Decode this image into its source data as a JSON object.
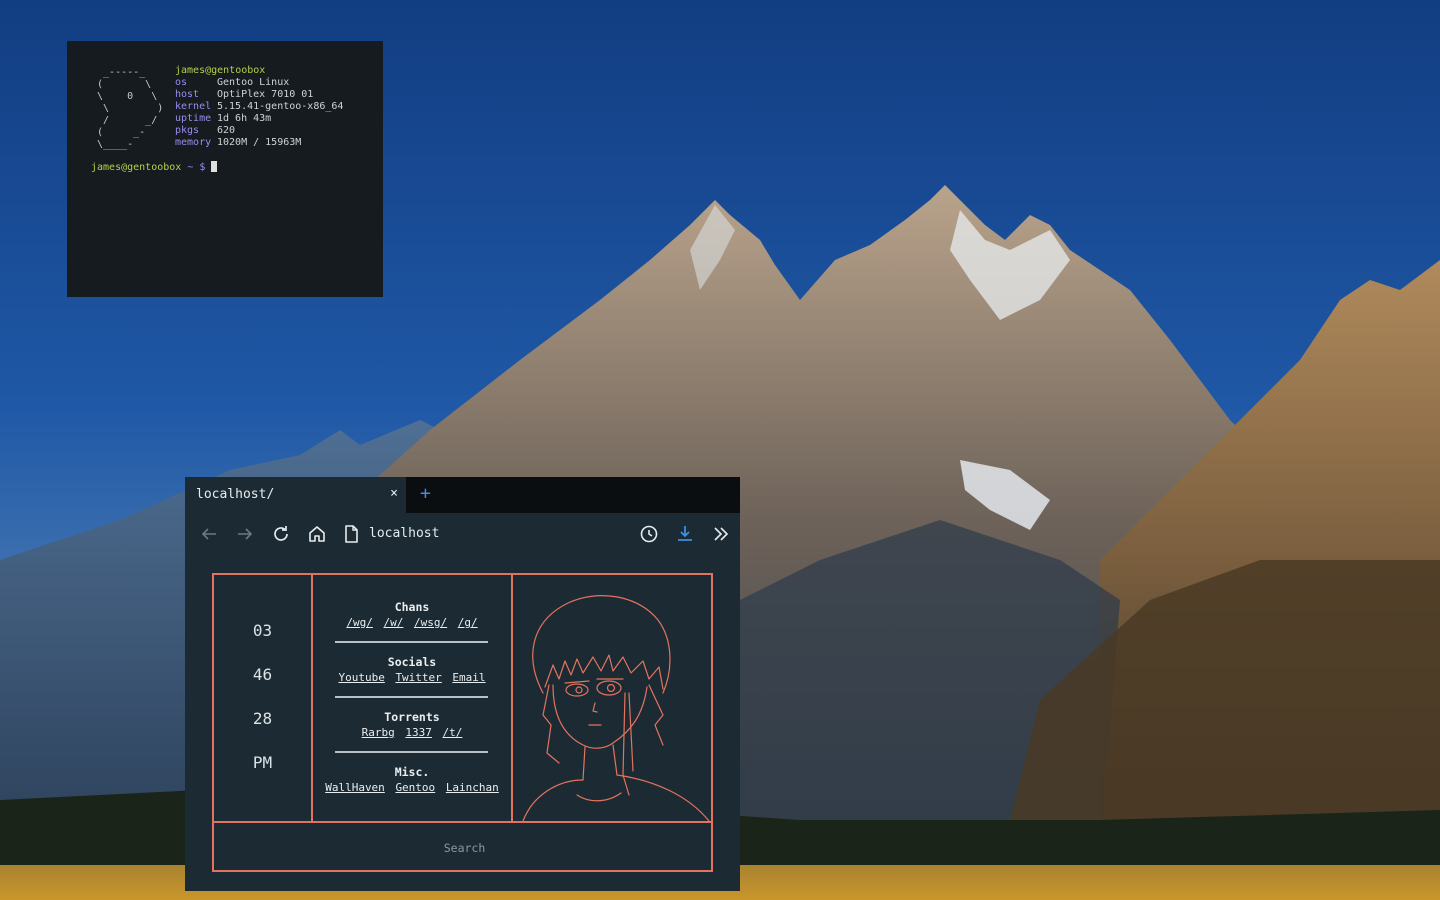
{
  "terminal": {
    "ascii_art": [
      "  _-----_",
      " (       \\",
      " \\    0   \\",
      "  \\        )",
      "  /      _/",
      " (     _-",
      " \\____-"
    ],
    "user_host": "james@gentoobox",
    "info": [
      {
        "key": "os",
        "value": "Gentoo Linux"
      },
      {
        "key": "host",
        "value": "OptiPlex 7010 01"
      },
      {
        "key": "kernel",
        "value": "5.15.41-gentoo-x86_64"
      },
      {
        "key": "uptime",
        "value": "1d 6h 43m"
      },
      {
        "key": "pkgs",
        "value": "620"
      },
      {
        "key": "memory",
        "value": "1020M / 15963M"
      }
    ],
    "prompt_user": "james@gentoobox",
    "prompt_suffix": " ~ $ "
  },
  "browser": {
    "tab_title": "localhost/",
    "tab_close": "×",
    "new_tab": "+",
    "url": "localhost",
    "icons": {
      "back": "arrow-left-icon",
      "forward": "arrow-right-icon",
      "reload": "reload-icon",
      "home": "home-icon",
      "page": "page-icon",
      "history": "clock-icon",
      "downloads": "download-icon",
      "overflow": "double-chevron-icon"
    },
    "accent": "#3d8fe0"
  },
  "startpage": {
    "clock": {
      "hours": "03",
      "minutes": "46",
      "seconds": "28",
      "period": "PM"
    },
    "sections": [
      {
        "title": "Chans",
        "links": [
          "/wg/",
          "/w/",
          "/wsg/",
          "/g/"
        ]
      },
      {
        "title": "Socials",
        "links": [
          "Youtube",
          "Twitter",
          "Email"
        ]
      },
      {
        "title": "Torrents",
        "links": [
          "Rarbg",
          "1337",
          "/t/"
        ]
      },
      {
        "title": "Misc.",
        "links": [
          "WallHaven",
          "Gentoo",
          "Lainchan"
        ]
      }
    ],
    "search_placeholder": "Search",
    "colors": {
      "border": "#e3735e",
      "background": "#1c2b33"
    }
  }
}
